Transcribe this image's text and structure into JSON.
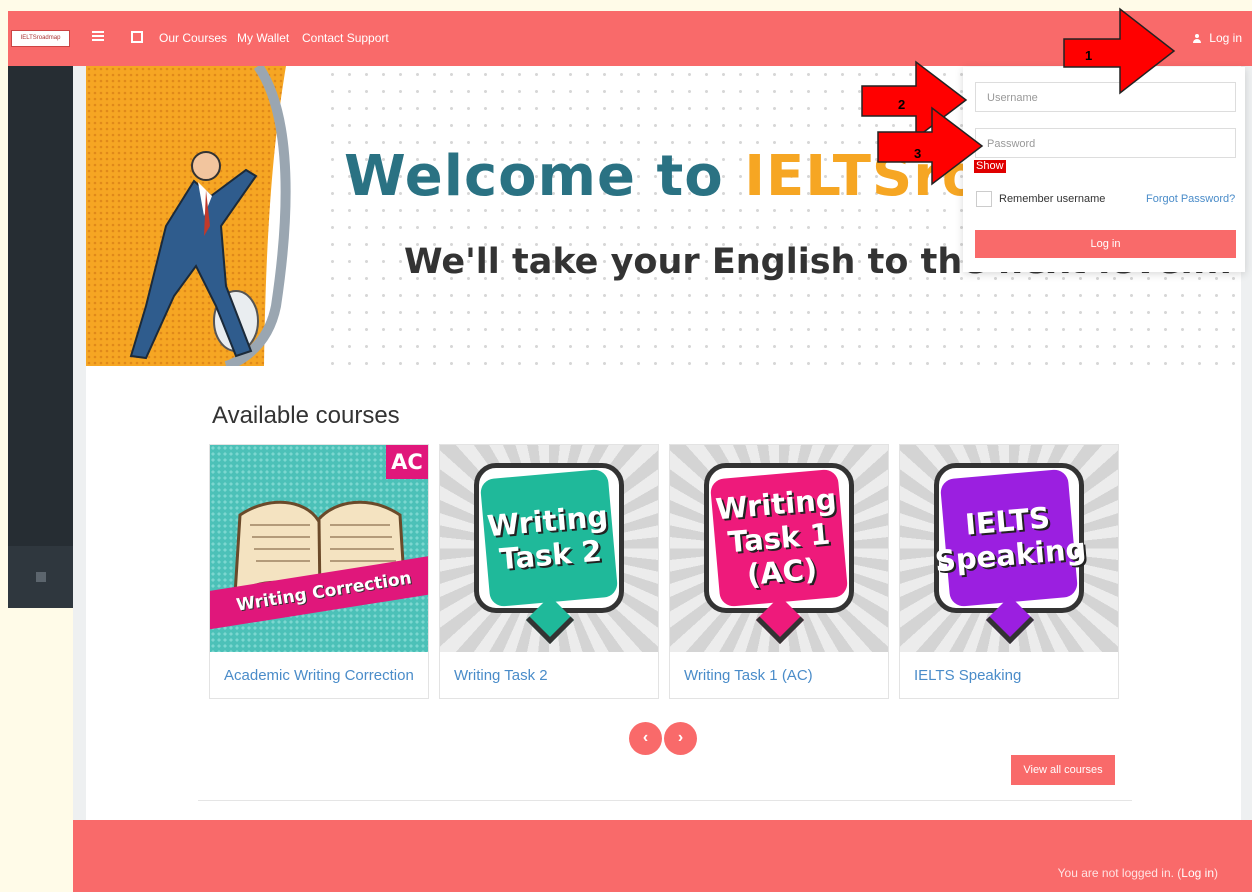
{
  "navbar": {
    "brand_text": "IELTSroadmap",
    "links": [
      "Our Courses",
      "My Wallet",
      "Contact Support"
    ],
    "login_label": "Log in"
  },
  "hero": {
    "title_prefix": "Welcome to ",
    "title_brand": "IELTSroad",
    "subtitle": "We'll take your English to the next level..."
  },
  "courses": {
    "heading": "Available courses",
    "items": [
      {
        "name": "Academic Writing Correction",
        "art_text": "Writing Correction",
        "badge": "AC",
        "color": "#2ec4b6"
      },
      {
        "name": "Writing Task 2",
        "art_text": "Writing Task 2",
        "color": "#1fb99a"
      },
      {
        "name": "Writing Task 1 (AC)",
        "art_text": "Writing Task 1 (AC)",
        "color": "#ee1a7b"
      },
      {
        "name": "IELTS Speaking",
        "art_text": "IELTS Speaking",
        "color": "#9b1fe0"
      }
    ],
    "prev_icon": "chevron-left-icon",
    "next_icon": "chevron-right-icon",
    "view_all_label": "View all courses"
  },
  "login_form": {
    "username_placeholder": "Username",
    "password_placeholder": "Password",
    "show_label": "Show",
    "remember_label": "Remember username",
    "forgot_label": "Forgot Password?",
    "submit_label": "Log in"
  },
  "annotations": [
    "1",
    "2",
    "3"
  ],
  "footer": {
    "status_text": "You are not logged in. (",
    "login_link": "Log in",
    "status_close": ")"
  },
  "colors": {
    "accent": "#f96a6a",
    "sidebar": "#262d33",
    "title_teal": "#2a7283",
    "title_orange": "#f6a623",
    "link_blue": "#4a8cc9",
    "arrow_red": "#ff0000"
  }
}
